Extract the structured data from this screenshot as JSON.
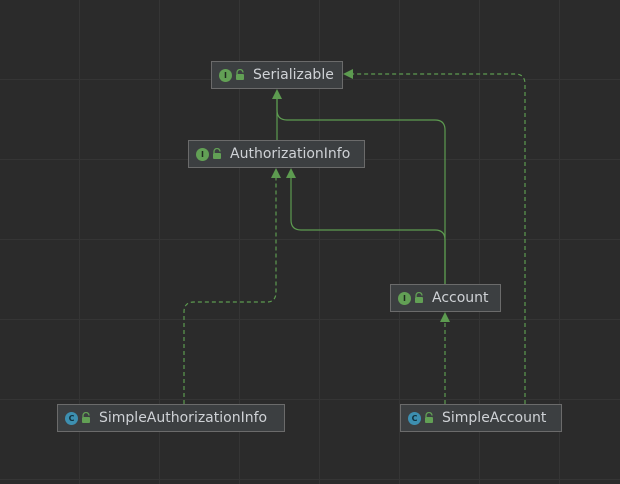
{
  "nodes": {
    "serializable": {
      "label": "Serializable",
      "kind": "interface",
      "badge": "I"
    },
    "authorization_info": {
      "label": "AuthorizationInfo",
      "kind": "interface",
      "badge": "I"
    },
    "account": {
      "label": "Account",
      "kind": "interface",
      "badge": "I"
    },
    "simple_authorization_info": {
      "label": "SimpleAuthorizationInfo",
      "kind": "class",
      "badge": "C"
    },
    "simple_account": {
      "label": "SimpleAccount",
      "kind": "class",
      "badge": "C"
    }
  },
  "edges": [
    {
      "from": "authorization_info",
      "to": "serializable",
      "style": "extends-solid"
    },
    {
      "from": "account",
      "to": "serializable",
      "style": "extends-solid"
    },
    {
      "from": "account",
      "to": "authorization_info",
      "style": "extends-solid"
    },
    {
      "from": "simple_authorization_info",
      "to": "authorization_info",
      "style": "implements-dashed"
    },
    {
      "from": "simple_account",
      "to": "account",
      "style": "implements-dashed"
    },
    {
      "from": "simple_account",
      "to": "serializable",
      "style": "implements-dashed"
    }
  ],
  "colors": {
    "background": "#2b2b2b",
    "grid": "#353535",
    "node_fill": "#3c3f41",
    "node_border": "#6b6b6b",
    "edge": "#5d9b50",
    "interface_badge": "#62a055",
    "class_badge": "#3d8fb0"
  }
}
